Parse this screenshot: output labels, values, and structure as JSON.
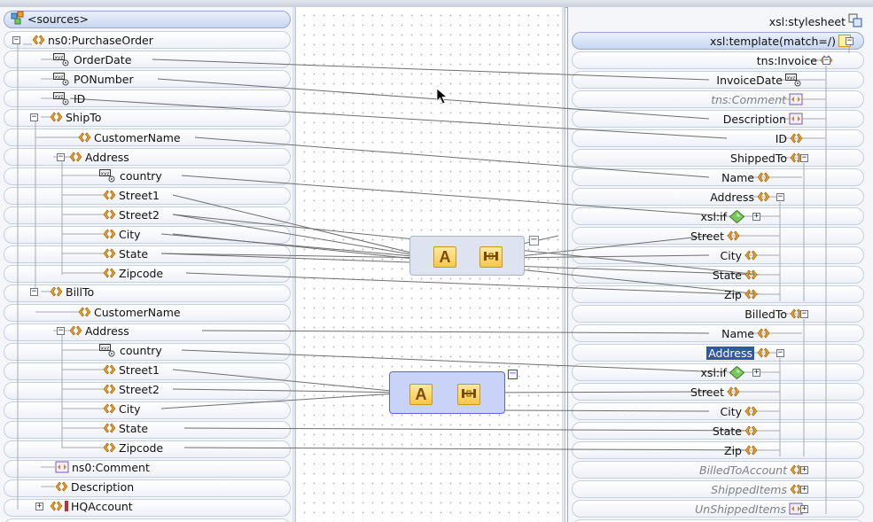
{
  "source_tree": {
    "root_label": "<sources>",
    "purchase_order": "ns0:PurchaseOrder",
    "order_date": "OrderDate",
    "po_number": "PONumber",
    "id": "ID",
    "ship_to": "ShipTo",
    "ship_customer_name": "CustomerName",
    "ship_address": "Address",
    "ship_country": "country",
    "ship_street1": "Street1",
    "ship_street2": "Street2",
    "ship_city": "City",
    "ship_state": "State",
    "ship_zipcode": "Zipcode",
    "bill_to": "BillTo",
    "bill_customer_name": "CustomerName",
    "bill_address": "Address",
    "bill_country": "country",
    "bill_street1": "Street1",
    "bill_street2": "Street2",
    "bill_city": "City",
    "bill_state": "State",
    "bill_zipcode": "Zipcode",
    "comment": "ns0:Comment",
    "description": "Description",
    "hq_account": "HQAccount"
  },
  "target_tree": {
    "stylesheet": "xsl:stylesheet",
    "template": "xsl:template(match=/)",
    "invoice": "tns:Invoice",
    "invoice_date": "InvoiceDate",
    "comment": "tns:Comment",
    "description": "Description",
    "id": "ID",
    "shipped_to": "ShippedTo",
    "ship_name": "Name",
    "ship_address": "Address",
    "ship_if": "xsl:if",
    "ship_street": "Street",
    "ship_city": "City",
    "ship_state": "State",
    "ship_zip": "Zip",
    "billed_to": "BilledTo",
    "bill_name": "Name",
    "bill_address": "Address",
    "bill_if": "xsl:if",
    "bill_street": "Street",
    "bill_city": "City",
    "bill_state": "State",
    "bill_zip": "Zip",
    "billed_to_account": "BilledToAccount",
    "shipped_items": "ShippedItems",
    "unshipped_items": "UnShippedItems"
  },
  "functoids": {
    "upper": {
      "first_label": "A",
      "second_icon": "concat-function-icon"
    },
    "lower": {
      "first_label": "A",
      "second_icon": "concat-function-icon"
    }
  },
  "controls": {
    "expanded_symbol": "−",
    "collapsed_symbol": "+"
  },
  "colors": {
    "selection": "#2e5a9f",
    "connector": "#6e6e6e",
    "element_icon": "#f0a020",
    "functoid_selected": "#5b66d8"
  }
}
